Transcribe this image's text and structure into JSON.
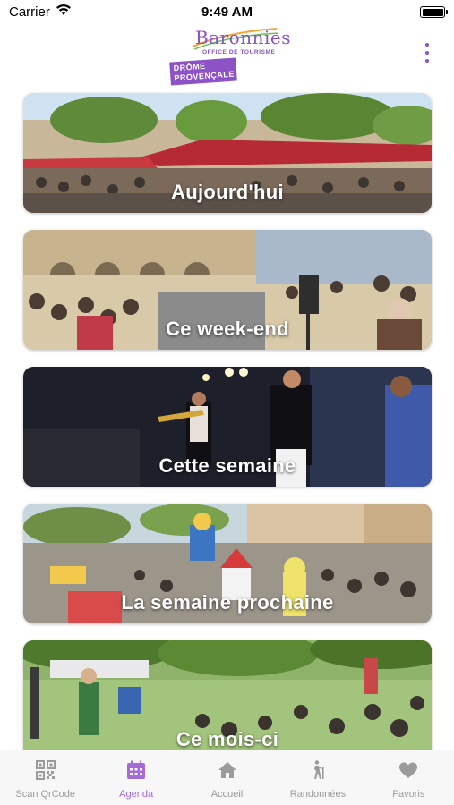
{
  "status_bar": {
    "carrier": "Carrier",
    "time": "9:49 AM"
  },
  "header": {
    "logo_title": "Baronnies",
    "logo_subtitle": "OFFICE DE TOURISME",
    "logo_tag_line1": "DRÔME",
    "logo_tag_line2": "PROVENÇALE",
    "menu_icon": "more-vertical-icon"
  },
  "cards": [
    {
      "label": "Aujourd'hui"
    },
    {
      "label": "Ce week-end"
    },
    {
      "label": "Cette semaine"
    },
    {
      "label": "La semaine prochaine"
    },
    {
      "label": "Ce mois-ci"
    }
  ],
  "tab_bar": {
    "items": [
      {
        "label": "Scan QrCode",
        "icon": "qr-code-icon",
        "active": false
      },
      {
        "label": "Agenda",
        "icon": "calendar-icon",
        "active": true
      },
      {
        "label": "Accueil",
        "icon": "home-icon",
        "active": false
      },
      {
        "label": "Randonnées",
        "icon": "hiker-icon",
        "active": false
      },
      {
        "label": "Favoris",
        "icon": "heart-icon",
        "active": false
      }
    ]
  },
  "colors": {
    "accent": "#8c52c6",
    "tab_active": "#a56bd6",
    "tab_inactive": "#9b9b9b"
  }
}
